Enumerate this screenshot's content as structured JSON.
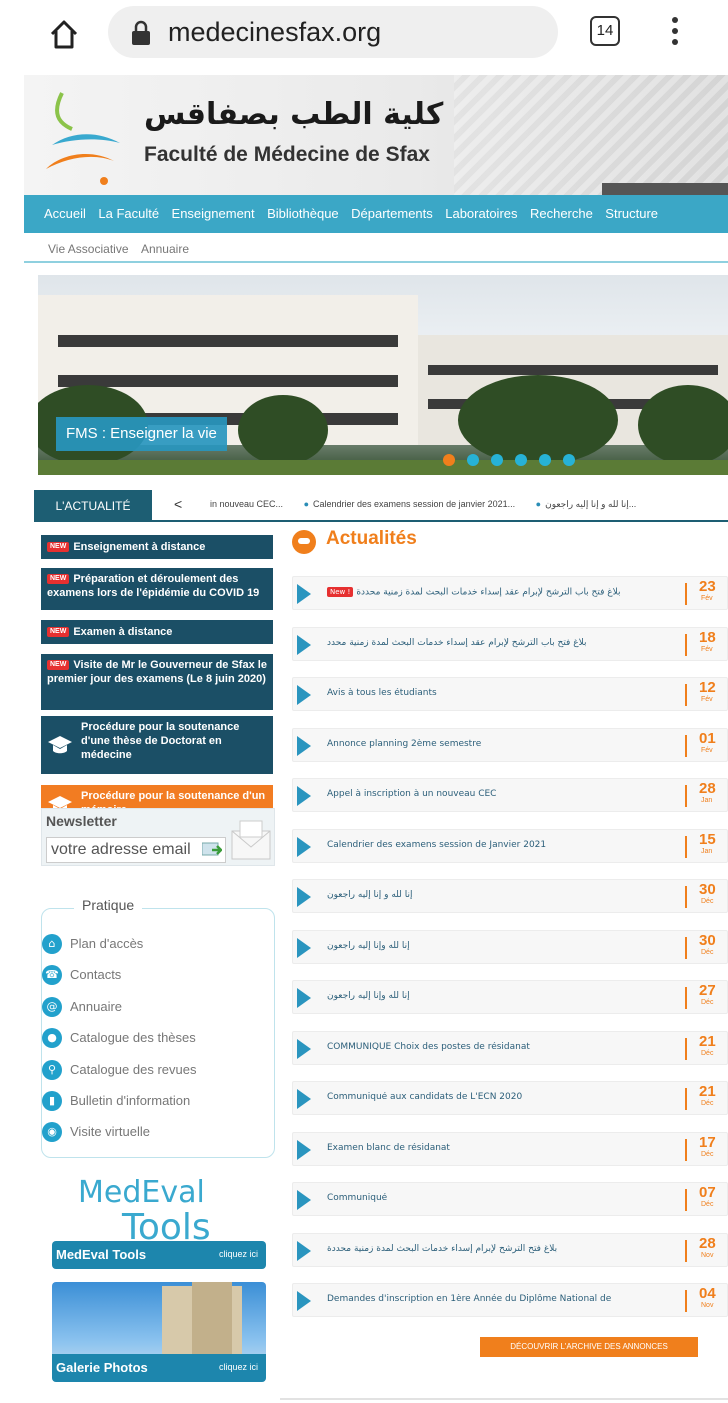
{
  "browser": {
    "url": "medecinesfax.org",
    "tab_count": "14"
  },
  "header": {
    "title_ar": "كلية الطب بصفاقس",
    "title_fr": "Faculté de Médecine de Sfax"
  },
  "nav": {
    "items": [
      "Accueil",
      "La Faculté",
      "Enseignement",
      "Bibliothèque",
      "Départements",
      "Laboratoires",
      "Recherche",
      "Structure"
    ],
    "sub_items": [
      "Vie Associative",
      "Annuaire"
    ]
  },
  "slider": {
    "caption": "FMS : Enseigner la vie"
  },
  "ticker": {
    "label": "L'ACTUALITÉ",
    "prev": "<",
    "items": [
      "in nouveau CEC...",
      "Calendrier des examens session de janvier 2021...",
      "إنا لله و إنا إليه راجعون..."
    ]
  },
  "sidebar": {
    "new_tag": "NEW",
    "links": [
      {
        "label": "Enseignement à distance"
      },
      {
        "label": "Préparation et déroulement des examens lors de l'épidémie du COVID 19"
      },
      {
        "label": "Examen à distance"
      },
      {
        "label": "Visite de Mr le Gouverneur de Sfax le premier jour des examens (Le 8 juin 2020)"
      },
      {
        "label": "Procédure pour la soutenance d'une thèse de Doctorat en médecine"
      },
      {
        "label": "Procédure pour la soutenance d'un mémoire"
      }
    ],
    "newsletter": {
      "title": "Newsletter",
      "placeholder": "votre adresse email"
    },
    "pratique": {
      "title": "Pratique",
      "items": [
        "Plan d'accès",
        "Contacts",
        "Annuaire",
        "Catalogue des thèses",
        "Catalogue des revues",
        "Bulletin d'information",
        "Visite virtuelle"
      ]
    },
    "medeval": {
      "logo_1": "MedEval",
      "logo_2": "Tools",
      "label": "MedEval Tools",
      "cta": "cliquez ici"
    },
    "galerie": {
      "label": "Galerie Photos",
      "cta": "cliquez ici"
    }
  },
  "actualites": {
    "title": "Actualités",
    "new_tag": "New !",
    "items": [
      {
        "title": "بلاغ فتح باب الترشح لإبرام عقد إسداء خدمات البحث لمدة زمنية محددة",
        "day": "23",
        "month": "Fév",
        "is_new": true
      },
      {
        "title": "بلاغ فتح باب الترشح لإبرام عقد إسداء خدمات البحث لمدة زمنية محدد",
        "day": "18",
        "month": "Fév"
      },
      {
        "title": "Avis à tous les étudiants",
        "day": "12",
        "month": "Fév"
      },
      {
        "title": "Annonce planning 2ème semestre",
        "day": "01",
        "month": "Fév"
      },
      {
        "title": "Appel à inscription à un nouveau CEC",
        "day": "28",
        "month": "Jan"
      },
      {
        "title": "Calendrier des examens session de Janvier 2021",
        "day": "15",
        "month": "Jan"
      },
      {
        "title": "إنا لله و إنا إليه راجعون",
        "day": "30",
        "month": "Déc"
      },
      {
        "title": "إنا لله وإنا إليه راجعون",
        "day": "30",
        "month": "Déc"
      },
      {
        "title": "إنا لله وإنا إليه راجعون",
        "day": "27",
        "month": "Déc"
      },
      {
        "title": "COMMUNIQUE Choix des postes de résidanat",
        "day": "21",
        "month": "Déc"
      },
      {
        "title": "Communiqué aux candidats de L'ECN 2020",
        "day": "21",
        "month": "Déc"
      },
      {
        "title": "Examen blanc de résidanat",
        "day": "17",
        "month": "Déc"
      },
      {
        "title": "Communiqué",
        "day": "07",
        "month": "Déc"
      },
      {
        "title": "بلاغ فتح الترشح لإبرام إسداء خدمات البحث لمدة زمنية محددة",
        "day": "28",
        "month": "Nov"
      },
      {
        "title": "Demandes d'inscription en 1ère Année du Diplôme National de",
        "day": "04",
        "month": "Nov"
      }
    ],
    "archive_button": "DÉCOUVRIR L'ARCHIVE DES ANNONCES"
  }
}
